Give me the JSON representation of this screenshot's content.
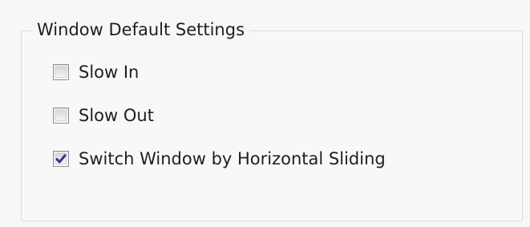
{
  "groupbox": {
    "title": "Window Default Settings",
    "options": [
      {
        "label": "Slow In",
        "checked": false
      },
      {
        "label": "Slow Out",
        "checked": false
      },
      {
        "label": "Switch Window by Horizontal Sliding",
        "checked": true
      }
    ]
  },
  "colors": {
    "background": "#f7f7f7",
    "text": "#1f1f1f",
    "check": "#2c3a8a"
  },
  "icons": {
    "checkmark": "check-icon"
  }
}
